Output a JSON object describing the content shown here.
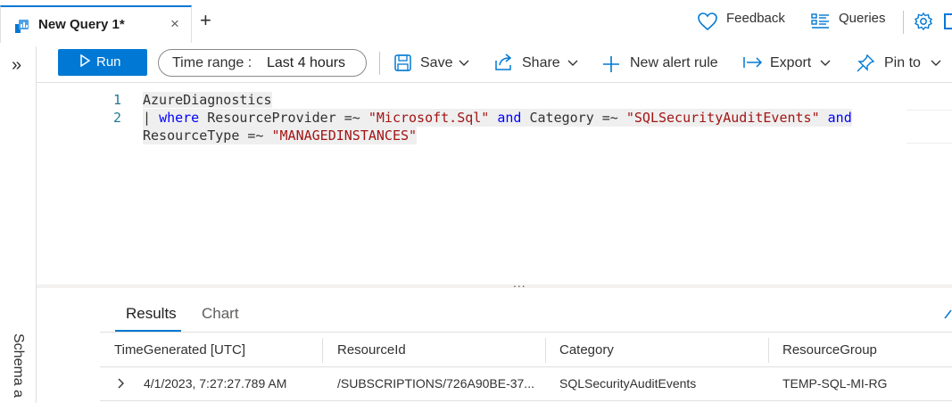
{
  "tab": {
    "title": "New Query 1*",
    "close": "×",
    "add": "+"
  },
  "header": {
    "feedback_label": "Feedback",
    "queries_label": "Queries"
  },
  "rail": {
    "expand": "»",
    "schema_label": "Schema a"
  },
  "toolbar": {
    "run_label": "Run",
    "time_range_key": "Time range :",
    "time_range_value": "Last 4 hours",
    "save_label": "Save",
    "share_label": "Share",
    "new_alert_label": "New alert rule",
    "export_label": "Export",
    "pin_label": "Pin to"
  },
  "editor": {
    "line_numbers": [
      "1",
      "2"
    ],
    "line1": "AzureDiagnostics",
    "line2_pipe": "| ",
    "line2_where": "where",
    "line2_a": " ResourceProvider =~ ",
    "line2_s1": "\"Microsoft.Sql\"",
    "line2_and1": " and",
    "line2_b": " Category =~ ",
    "line2_s2": "\"SQLSecurityAuditEvents\"",
    "line2_and2": " and",
    "line3_a": "ResourceType =~ ",
    "line3_s": "\"MANAGEDINSTANCES\""
  },
  "splitter": "...",
  "results": {
    "tabs": [
      "Results",
      "Chart"
    ],
    "columns": [
      "TimeGenerated [UTC]",
      "ResourceId",
      "Category",
      "ResourceGroup"
    ],
    "rows": [
      [
        "4/1/2023, 7:27:27.789 AM",
        "/SUBSCRIPTIONS/726A90BE-37...",
        "SQLSecurityAuditEvents",
        "TEMP-SQL-MI-RG"
      ]
    ]
  },
  "colors": {
    "accent": "#0078d4",
    "keyword": "#0000ff",
    "string": "#a31515"
  }
}
